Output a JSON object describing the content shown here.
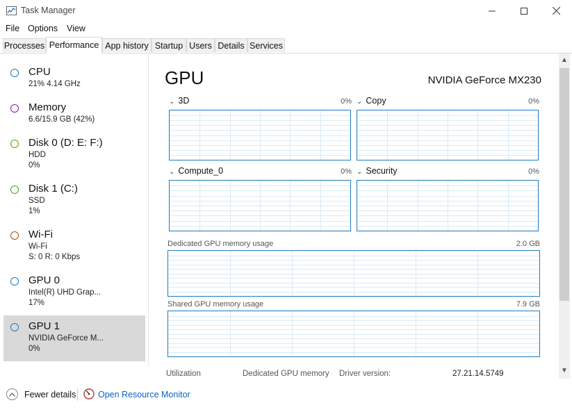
{
  "window": {
    "title": "Task Manager",
    "icon": "task-manager-icon",
    "controls": [
      "minimize-icon",
      "maximize-icon",
      "close-icon"
    ]
  },
  "menu": [
    "File",
    "Options",
    "View"
  ],
  "tabs": [
    "Processes",
    "Performance",
    "App history",
    "Startup",
    "Users",
    "Details",
    "Services"
  ],
  "active_tab": "Performance",
  "sidebar": [
    {
      "title": "CPU",
      "line1": "21%  4.14 GHz",
      "line2": "",
      "color": "#1d7bbf"
    },
    {
      "title": "Memory",
      "line1": "6.6/15.9 GB (42%)",
      "line2": "",
      "color": "#8b12ae"
    },
    {
      "title": "Disk 0 (D: E: F:)",
      "line1": "HDD",
      "line2": "0%",
      "color": "#4da60c"
    },
    {
      "title": "Disk 1 (C:)",
      "line1": "SSD",
      "line2": "1%",
      "color": "#4da60c"
    },
    {
      "title": "Wi-Fi",
      "line1": "Wi-Fi",
      "line2": "S: 0  R: 0 Kbps",
      "color": "#a74f01"
    },
    {
      "title": "GPU 0",
      "line1": "Intel(R) UHD Grap...",
      "line2": "17%",
      "color": "#1d7bbf"
    },
    {
      "title": "GPU 1",
      "line1": "NVIDIA GeForce M...",
      "line2": "0%",
      "color": "#1d7bbf",
      "selected": true
    }
  ],
  "main": {
    "title": "GPU",
    "device_name": "NVIDIA GeForce MX230",
    "engines": [
      {
        "label": "3D",
        "value": "0%"
      },
      {
        "label": "Copy",
        "value": "0%"
      },
      {
        "label": "Compute_0",
        "value": "0%"
      },
      {
        "label": "Security",
        "value": "0%"
      }
    ],
    "dedicated_memory": {
      "label": "Dedicated GPU memory usage",
      "value": "2.0 GB"
    },
    "shared_memory": {
      "label": "Shared GPU memory usage",
      "value": "7.9 GB"
    },
    "stats": {
      "utilization_label": "Utilization",
      "dedicated_label": "Dedicated GPU memory",
      "driver_label": "Driver version:",
      "driver_value": "27.21.14.5749"
    }
  },
  "footer": {
    "fewer_details": "Fewer details",
    "resource_monitor": "Open Resource Monitor"
  },
  "colors": {
    "graph_border": "#1d7bbf",
    "grid": "#d9eaf7",
    "link": "#0a64c2"
  }
}
